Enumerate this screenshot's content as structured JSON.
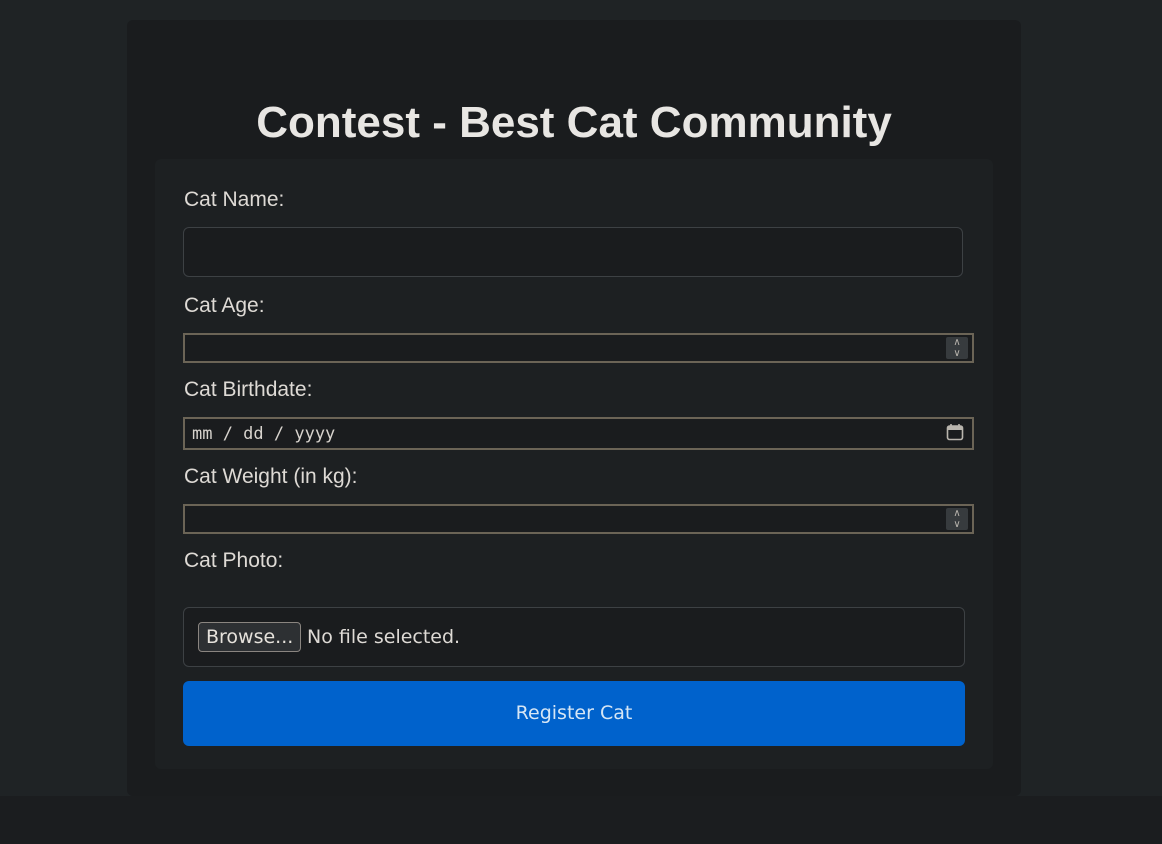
{
  "page": {
    "title": "Contest - Best Cat Community"
  },
  "form": {
    "name_label": "Cat Name:",
    "name_value": "",
    "age_label": "Cat Age:",
    "age_value": "",
    "birthdate_label": "Cat Birthdate:",
    "birthdate_placeholder": "mm / dd / yyyy",
    "weight_label": "Cat Weight (in kg):",
    "weight_value": "",
    "photo_label": "Cat Photo:",
    "browse_label": "Browse...",
    "file_status": "No file selected.",
    "submit_label": "Register Cat"
  },
  "icons": {
    "spinner": "spinner-icon",
    "calendar": "calendar-icon"
  },
  "colors": {
    "accent": "#0062cc",
    "background": "#1f2325",
    "card": "#1d2022"
  }
}
